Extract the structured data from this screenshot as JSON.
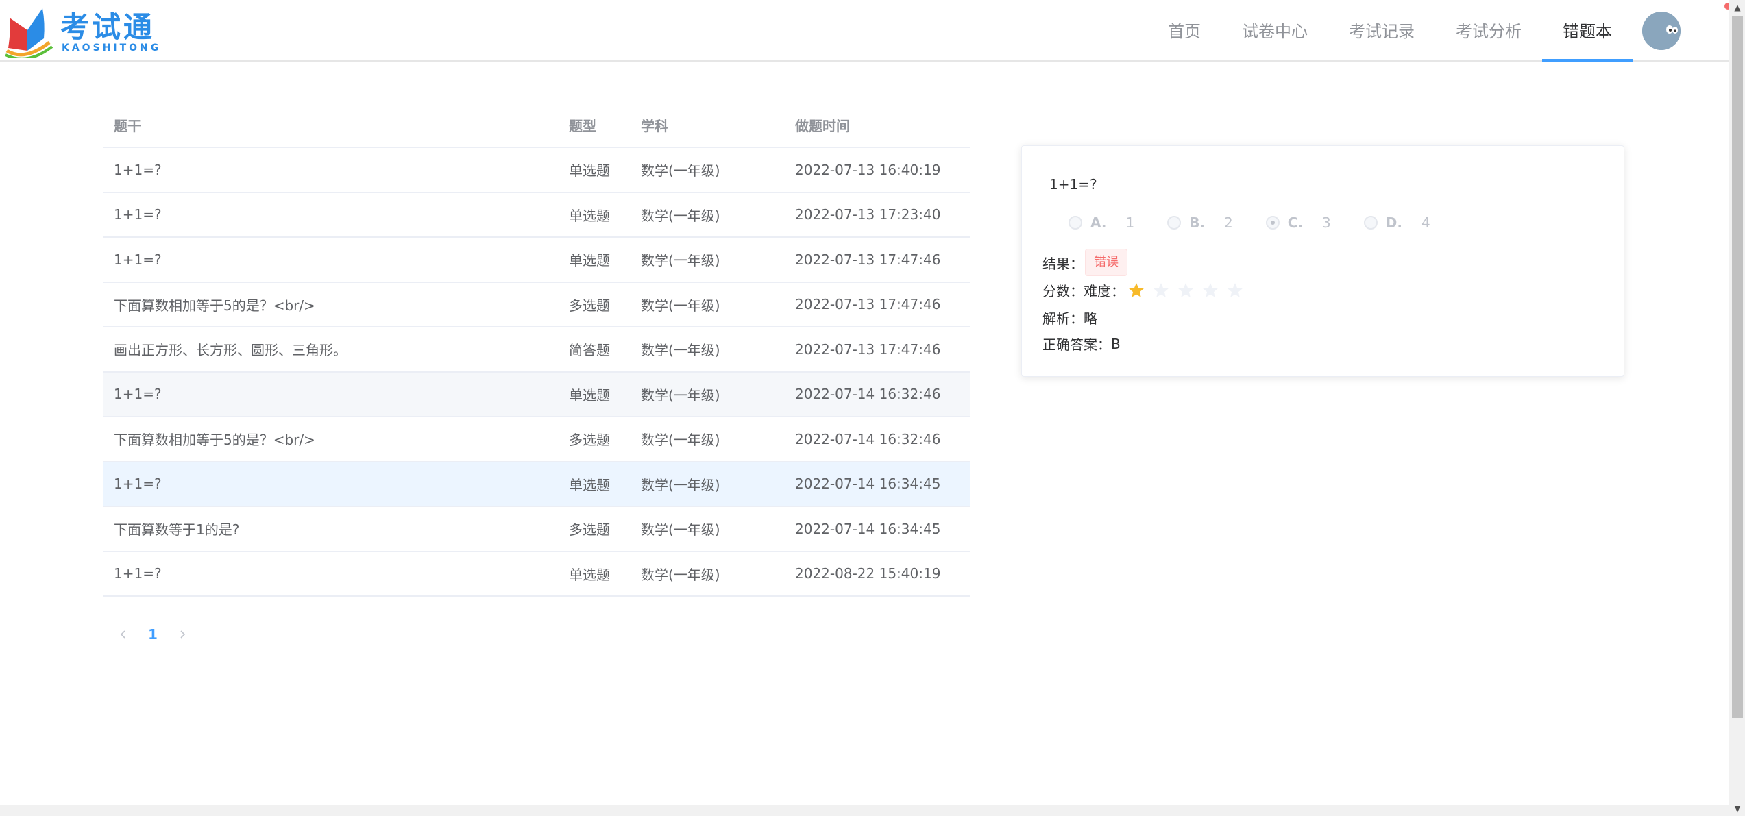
{
  "brand": {
    "name": "考试通",
    "sub": "KAOSHITONG",
    "color": "#2b8ce6"
  },
  "nav": {
    "items": [
      {
        "label": "首页"
      },
      {
        "label": "试卷中心"
      },
      {
        "label": "考试记录"
      },
      {
        "label": "考试分析"
      },
      {
        "label": "错题本"
      }
    ],
    "active_index": 4,
    "accent": "#409eff"
  },
  "table": {
    "headers": {
      "stem": "题干",
      "type": "题型",
      "subject": "学科",
      "time": "做题时间"
    },
    "rows": [
      {
        "stem": "1+1=?",
        "type": "单选题",
        "subject": "数学(一年级)",
        "time": "2022-07-13 16:40:19"
      },
      {
        "stem": "1+1=?",
        "type": "单选题",
        "subject": "数学(一年级)",
        "time": "2022-07-13 17:23:40"
      },
      {
        "stem": "1+1=?",
        "type": "单选题",
        "subject": "数学(一年级)",
        "time": "2022-07-13 17:47:46"
      },
      {
        "stem": "下面算数相加等于5的是？<br/>",
        "type": "多选题",
        "subject": "数学(一年级)",
        "time": "2022-07-13 17:47:46"
      },
      {
        "stem": "画出正方形、长方形、圆形、三角形。",
        "type": "简答题",
        "subject": "数学(一年级)",
        "time": "2022-07-13 17:47:46"
      },
      {
        "stem": "1+1=?",
        "type": "单选题",
        "subject": "数学(一年级)",
        "time": "2022-07-14 16:32:46"
      },
      {
        "stem": "下面算数相加等于5的是？<br/>",
        "type": "多选题",
        "subject": "数学(一年级)",
        "time": "2022-07-14 16:32:46"
      },
      {
        "stem": "1+1=?",
        "type": "单选题",
        "subject": "数学(一年级)",
        "time": "2022-07-14 16:34:45"
      },
      {
        "stem": "下面算数等于1的是?",
        "type": "多选题",
        "subject": "数学(一年级)",
        "time": "2022-07-14 16:34:45"
      },
      {
        "stem": "1+1=?",
        "type": "单选题",
        "subject": "数学(一年级)",
        "time": "2022-08-22 15:40:19"
      }
    ],
    "hover_row": 5,
    "current_row": 7
  },
  "pagination": {
    "current_page": "1",
    "prev_icon": "chevron-left-icon",
    "next_icon": "chevron-right-icon"
  },
  "detail": {
    "stem": "1+1=?",
    "options": [
      {
        "letter": "A.",
        "text": "1",
        "checked": false
      },
      {
        "letter": "B.",
        "text": "2",
        "checked": false
      },
      {
        "letter": "C.",
        "text": "3",
        "checked": true
      },
      {
        "letter": "D.",
        "text": "4",
        "checked": false
      }
    ],
    "result_label": "结果：",
    "result_value": "错误",
    "score_label": "分数：",
    "difficulty_label": "难度：",
    "difficulty_value": 1,
    "difficulty_max": 5,
    "analysis_label": "解析：",
    "analysis_value": "略",
    "answer_label": "正确答案：",
    "answer_value": "B",
    "colors": {
      "error": "#f56c6c",
      "star_on": "#f7ba2a",
      "star_off": "#eff2f7"
    }
  }
}
